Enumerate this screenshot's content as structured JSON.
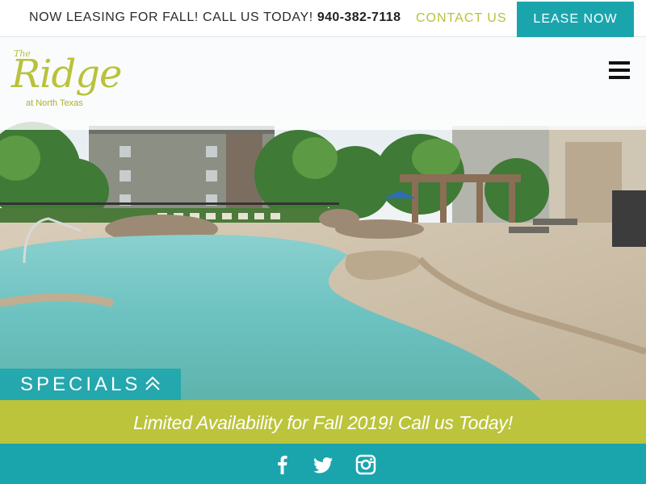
{
  "topbar": {
    "leasing_message": "NOW LEASING FOR FALL! CALL US TODAY!",
    "phone": "940-382-7118",
    "contact_label": "CONTACT US",
    "lease_now_label": "LEASE NOW"
  },
  "logo": {
    "the": "The",
    "name": "Ridge",
    "subtitle": "at North Texas"
  },
  "header": {
    "menu_icon": "hamburger-menu-icon"
  },
  "specials": {
    "label": "SPECIALS",
    "icon": "double-chevron-up-icon"
  },
  "promo": {
    "text": "Limited Availability for Fall 2019! Call us Today!"
  },
  "social": {
    "items": [
      {
        "icon": "facebook-icon"
      },
      {
        "icon": "twitter-icon"
      },
      {
        "icon": "instagram-icon"
      }
    ]
  },
  "colors": {
    "accent_teal": "#1aa5ad",
    "accent_lime": "#bcc43c",
    "logo_lime": "#b9c23a"
  }
}
